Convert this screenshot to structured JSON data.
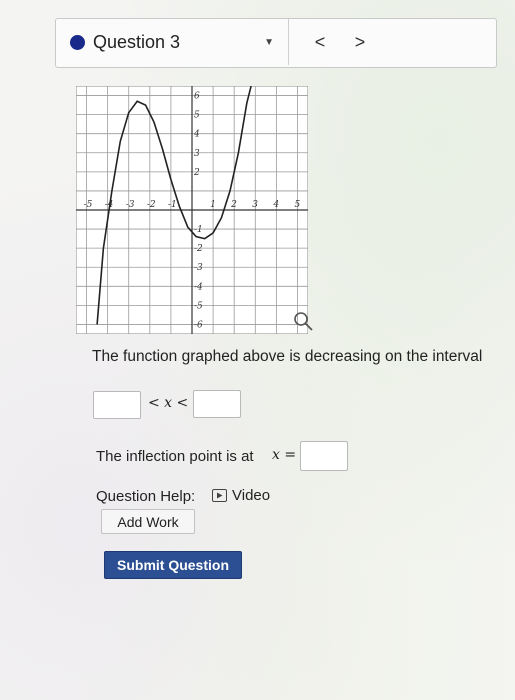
{
  "header": {
    "question_label": "Question 3",
    "prev_symbol": "<",
    "next_symbol": ">"
  },
  "graph": {
    "x_ticks": [
      "-5",
      "-4",
      "-3",
      "-2",
      "-1",
      "1",
      "2",
      "3",
      "4",
      "5"
    ],
    "y_ticks_pos": [
      "6",
      "5",
      "4",
      "3",
      "2"
    ],
    "y_ticks_neg": [
      "-1",
      "-2",
      "-3",
      "-4",
      "-5",
      "-6"
    ],
    "curve_points": [
      [
        -4.5,
        -6
      ],
      [
        -4.2,
        -2
      ],
      [
        -3.8,
        1
      ],
      [
        -3.4,
        3.6
      ],
      [
        -3.0,
        5.1
      ],
      [
        -2.6,
        5.7
      ],
      [
        -2.2,
        5.5
      ],
      [
        -1.8,
        4.6
      ],
      [
        -1.4,
        3.2
      ],
      [
        -1.0,
        1.6
      ],
      [
        -0.6,
        0.2
      ],
      [
        -0.2,
        -0.9
      ],
      [
        0.2,
        -1.4
      ],
      [
        0.6,
        -1.5
      ],
      [
        1.0,
        -1.2
      ],
      [
        1.4,
        -0.4
      ],
      [
        1.8,
        1.0
      ],
      [
        2.2,
        3.0
      ],
      [
        2.6,
        5.6
      ],
      [
        2.8,
        6.5
      ]
    ],
    "xlim": [
      -5.5,
      5.5
    ],
    "ylim": [
      -6.5,
      6.5
    ]
  },
  "problem": {
    "statement": "The function graphed above is decreasing on the interval",
    "interval_operator": "< x <",
    "inflection_text": "The inflection point is at",
    "inflection_var": "x =",
    "help_label": "Question Help:",
    "video_label": "Video",
    "add_work_label": "Add Work",
    "submit_label": "Submit Question"
  },
  "colors": {
    "accent": "#2b4f92",
    "dot": "#1a2a8a"
  }
}
